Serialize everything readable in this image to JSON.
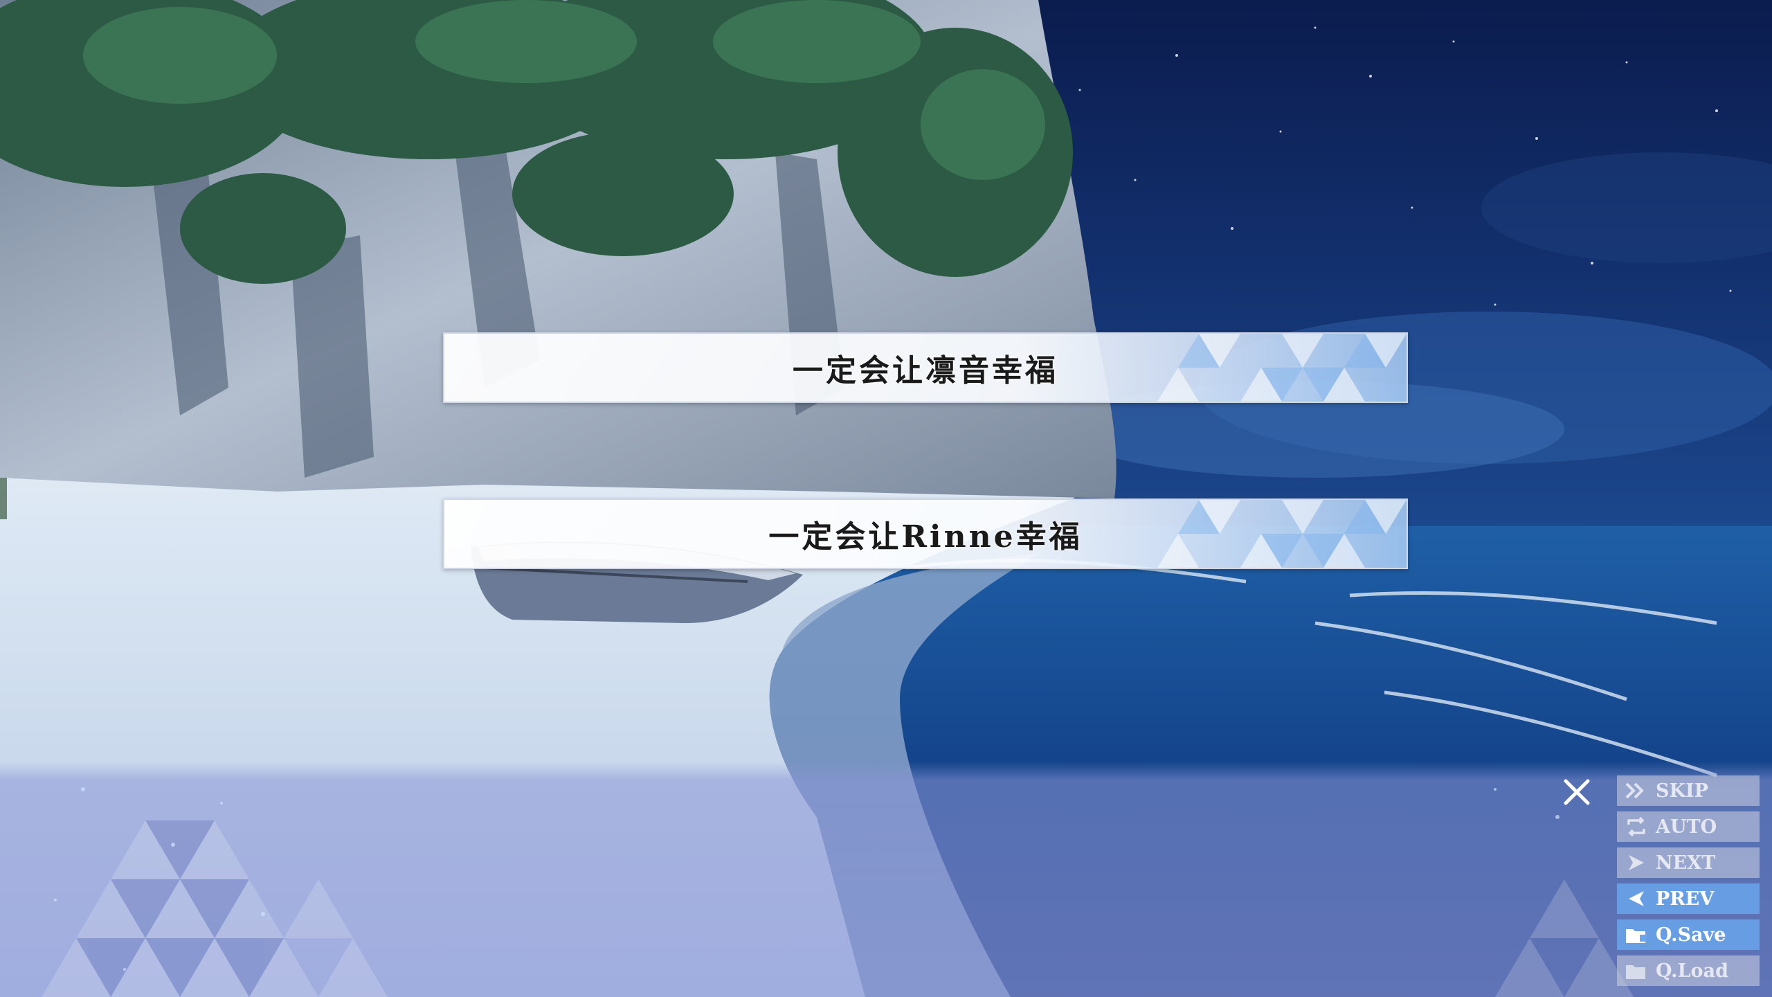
{
  "choices": [
    {
      "label": "一定会让凛音幸福"
    },
    {
      "label": "一定会让Rinne幸福"
    }
  ],
  "controls": {
    "skip": "SKIP",
    "auto": "AUTO",
    "next": "NEXT",
    "prev": "PREV",
    "qsave": "Q.Save",
    "qload": "Q.Load"
  },
  "colors": {
    "choice_accent": "#aacdf5",
    "button_active": "#69a5eb",
    "button_inactive": "#cdd2e1",
    "panel": "#8c96d7"
  },
  "icons": {
    "close": "close-icon",
    "skip": "double-chevron-right-icon",
    "auto": "repeat-icon",
    "next": "play-arrow-icon",
    "prev": "arrow-left-icon",
    "qsave": "folder-save-icon",
    "qload": "folder-load-icon"
  }
}
